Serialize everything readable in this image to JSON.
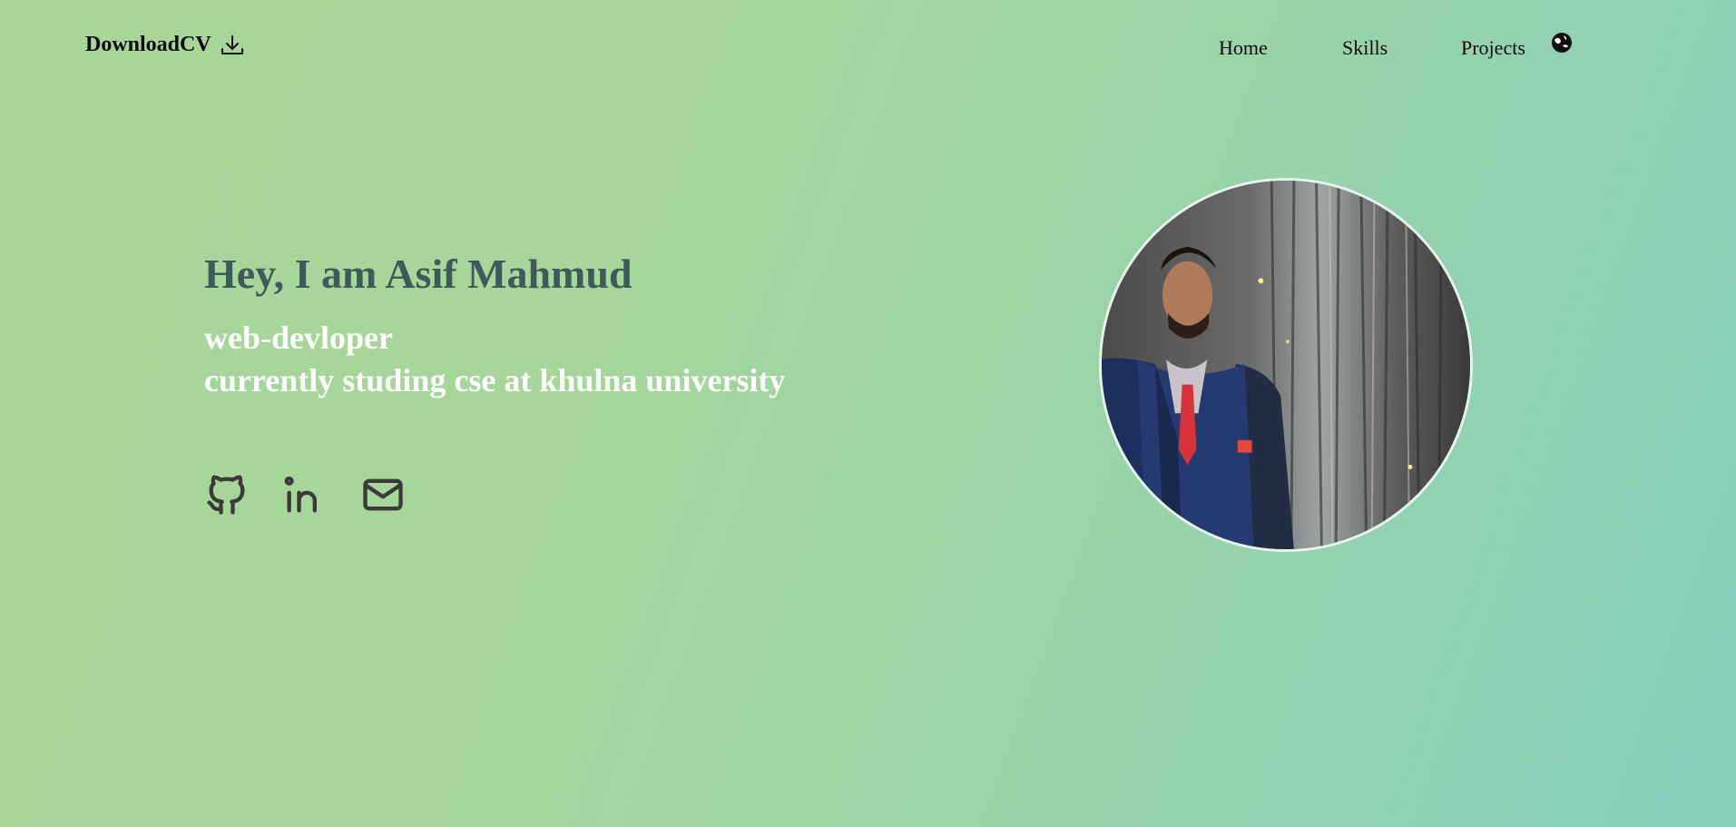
{
  "nav": {
    "cv_label": "DownloadCV",
    "links": [
      "Home",
      "Skills",
      "Projects"
    ]
  },
  "hero": {
    "heading": "Hey, I am Asif Mahmud",
    "role": "web-devloper",
    "education": "currently studing cse at khulna university"
  },
  "social": [
    "github-icon",
    "linkedin-icon",
    "mail-icon"
  ],
  "icons": {
    "cv": "download-icon",
    "theme": "theme-toggle-icon"
  },
  "colors": {
    "heading": "#3e5a5a",
    "subtext": "#ffffff",
    "icons": "#3a3a3a"
  }
}
